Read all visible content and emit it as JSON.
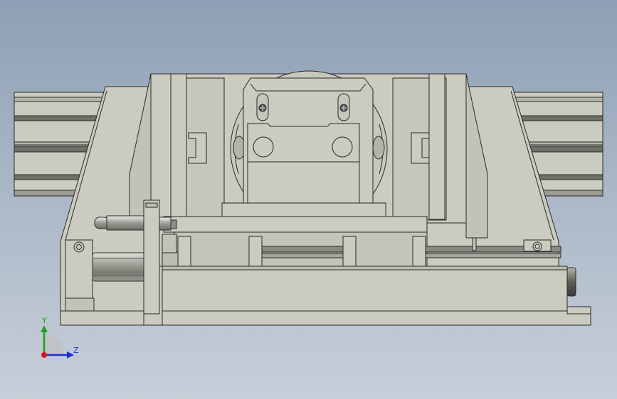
{
  "triad": {
    "y_label": "Y",
    "z_label": "Z",
    "colors": {
      "y": "#1ea01e",
      "z": "#1a2fd6",
      "x": "#d41a1a"
    }
  },
  "model_colors": {
    "body": "#cbcbc0",
    "body_shade": "#b8b8ad",
    "edge": "#2a2a2a",
    "rail_dark": "#7e7e76",
    "cylinder": "#9a9a92"
  }
}
